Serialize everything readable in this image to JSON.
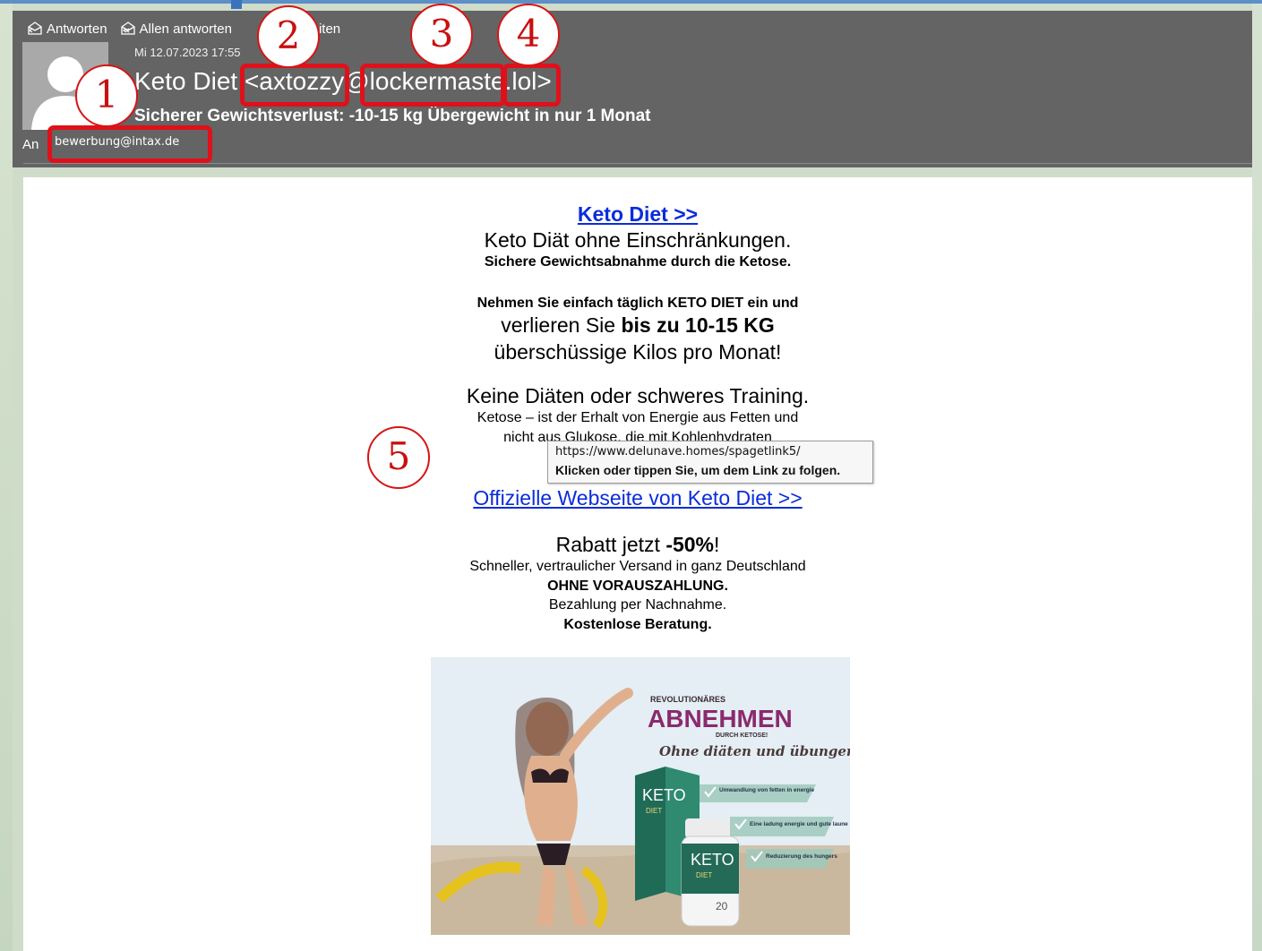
{
  "toolbar": {
    "reply": "Antworten",
    "reply_all": "Allen antworten",
    "forward": "Weiterleiten",
    "forward_visible": "erleiten"
  },
  "email": {
    "date": "Mi 12.07.2023 17:55",
    "sender_name": "Keto Diet",
    "sender_local": "<axtozzy",
    "sender_at": "@",
    "sender_domain": "lockermaste",
    "sender_tld": ".lol>",
    "subject": "Sicherer Gewichtsverlust: -10-15 kg Übergewicht in nur 1 Monat",
    "to_label": "An",
    "to_address": "bewerbung@intax.de"
  },
  "annotations": [
    "1",
    "2",
    "3",
    "4",
    "5"
  ],
  "body": {
    "top_link": "Keto Diet >>",
    "line1": "Keto Diät ohne Einschränkungen.",
    "line2": "Sichere Gewichtsabnahme durch die Ketose.",
    "line3": "Nehmen Sie einfach täglich KETO DIET ein und",
    "line4_pre": "verlieren Sie ",
    "line4_bold": "bis zu 10-15 KG",
    "line5": "überschüssige Kilos pro Monat!",
    "line6": "Keine Diäten oder schweres Training.",
    "line7": "Ketose – ist der Erhalt von Energie aus Fetten und",
    "line8": "nicht aus Glukose, die mit Kohlenhydraten",
    "official_link": "Offizielle Webseite von Keto Diet >>",
    "discount_pre": "Rabatt jetzt ",
    "discount_bold": "-50%",
    "discount_post": "!",
    "shipping": "Schneller, vertraulicher Versand in ganz Deutschland",
    "no_prepay": "OHNE VORAUSZAHLUNG.",
    "payment": "Bezahlung per Nachnahme.",
    "consult": "Kostenlose Beratung."
  },
  "tooltip": {
    "url": "https://www.delunave.homes/spagetlink5/",
    "hint": "Klicken oder tippen Sie, um dem Link zu folgen."
  },
  "promo": {
    "revolutionary": "REVOLUTIONÄRES",
    "headline": "ABNEHMEN",
    "sub": "DURCH KETOSE!",
    "tagline": "Ohne diäten und übungen!",
    "benefit1": "Umwandlung von fetten in energie",
    "benefit2": "Eine ladung energie und gute laune",
    "benefit3": "Reduzierung des hungers",
    "box_brand": "KETO",
    "box_sub": "DIET",
    "bottle_brand": "KETO",
    "bottle_sub": "DIET",
    "bottle_count": "20"
  },
  "colors": {
    "header_bg": "#646464",
    "annotation_red": "#e0101a",
    "link_blue": "#0a2cdc",
    "headline_purple": "#8a2a6e"
  }
}
